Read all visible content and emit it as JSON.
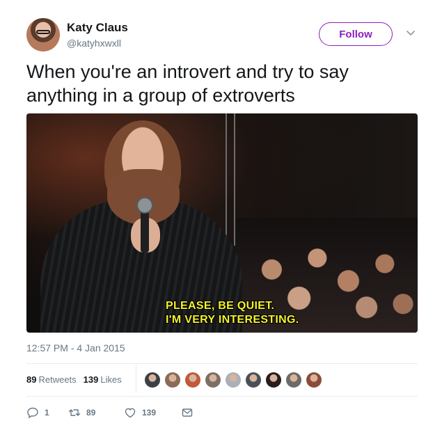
{
  "user": {
    "name": "Katy Claus",
    "handle": "@katyhxwxll",
    "follow_label": "Follow"
  },
  "tweet": {
    "text": "When you're an introvert and try to say anything in a group of extroverts",
    "media": {
      "subtitle_line1": "PLEASE, BE QUIET.",
      "subtitle_line2": "I'M VERY INTERESTING."
    },
    "timestamp": "12:57 PM - 4 Jan 2015"
  },
  "stats": {
    "retweets_count": "89",
    "retweets_label": "Retweets",
    "likes_count": "139",
    "likes_label": "Likes",
    "liker_avatar_colors": [
      "#3b3f46",
      "#8a6a58",
      "#c05a3c",
      "#7b6f66",
      "#a9b0b8",
      "#4a4f57",
      "#2a1e1a",
      "#6d6a68",
      "#8b4d3a"
    ]
  },
  "actions": {
    "reply_count": "1",
    "retweet_count": "89",
    "like_count": "139"
  },
  "icons": {
    "caret": "chevron-down-icon",
    "reply": "reply-icon",
    "retweet": "retweet-icon",
    "like": "heart-icon",
    "dm": "envelope-icon"
  },
  "colors": {
    "follow_accent": "#8c1fbf",
    "secondary_text": "#657786",
    "subtitle": "#f5f22c"
  }
}
